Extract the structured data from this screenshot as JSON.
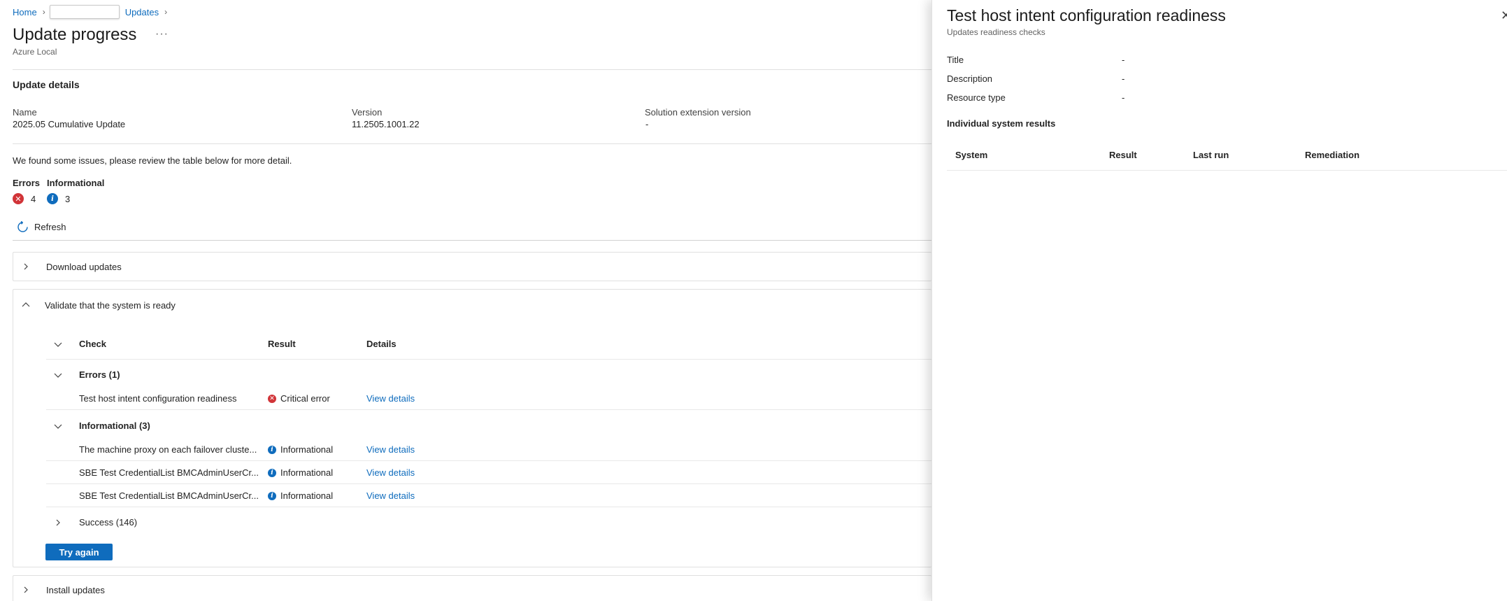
{
  "breadcrumb": {
    "home": "Home",
    "updates": "Updates"
  },
  "page": {
    "title": "Update progress",
    "more": "···",
    "subtitle": "Azure Local"
  },
  "details": {
    "section_title": "Update details",
    "name_label": "Name",
    "name_value": "2025.05 Cumulative Update",
    "version_label": "Version",
    "version_value": "11.2505.1001.22",
    "sev_label": "Solution extension version",
    "sev_value": "-"
  },
  "notice": "We found some issues, please review the table below for more detail.",
  "counts": {
    "errors_label": "Errors",
    "errors_value": "4",
    "info_label": "Informational",
    "info_value": "3"
  },
  "toolbar": {
    "refresh": "Refresh"
  },
  "stages": {
    "download": "Download updates",
    "validate": "Validate that the system is ready",
    "install": "Install updates"
  },
  "table": {
    "headers": {
      "check": "Check",
      "result": "Result",
      "details": "Details"
    },
    "groups": {
      "errors": "Errors (1)",
      "informational": "Informational (3)",
      "success": "Success (146)"
    },
    "rows": [
      {
        "check": "Test host intent configuration readiness",
        "result": "Critical error",
        "details": "View details"
      },
      {
        "check": "The machine proxy on each failover cluste...",
        "result": "Informational",
        "details": "View details"
      },
      {
        "check": "SBE Test CredentialList BMCAdminUserCr...",
        "result": "Informational",
        "details": "View details"
      },
      {
        "check": "SBE Test CredentialList BMCAdminUserCr...",
        "result": "Informational",
        "details": "View details"
      }
    ]
  },
  "actions": {
    "try_again": "Try again"
  },
  "panel": {
    "title": "Test host intent configuration readiness",
    "subtitle": "Updates readiness checks",
    "fields": [
      {
        "label": "Title",
        "value": "-"
      },
      {
        "label": "Description",
        "value": "-"
      },
      {
        "label": "Resource type",
        "value": "-"
      }
    ],
    "section": "Individual system results",
    "columns": {
      "system": "System",
      "result": "Result",
      "last_run": "Last run",
      "remediation": "Remediation"
    }
  },
  "colors": {
    "accent": "#0f6cbd",
    "error": "#d13438"
  }
}
